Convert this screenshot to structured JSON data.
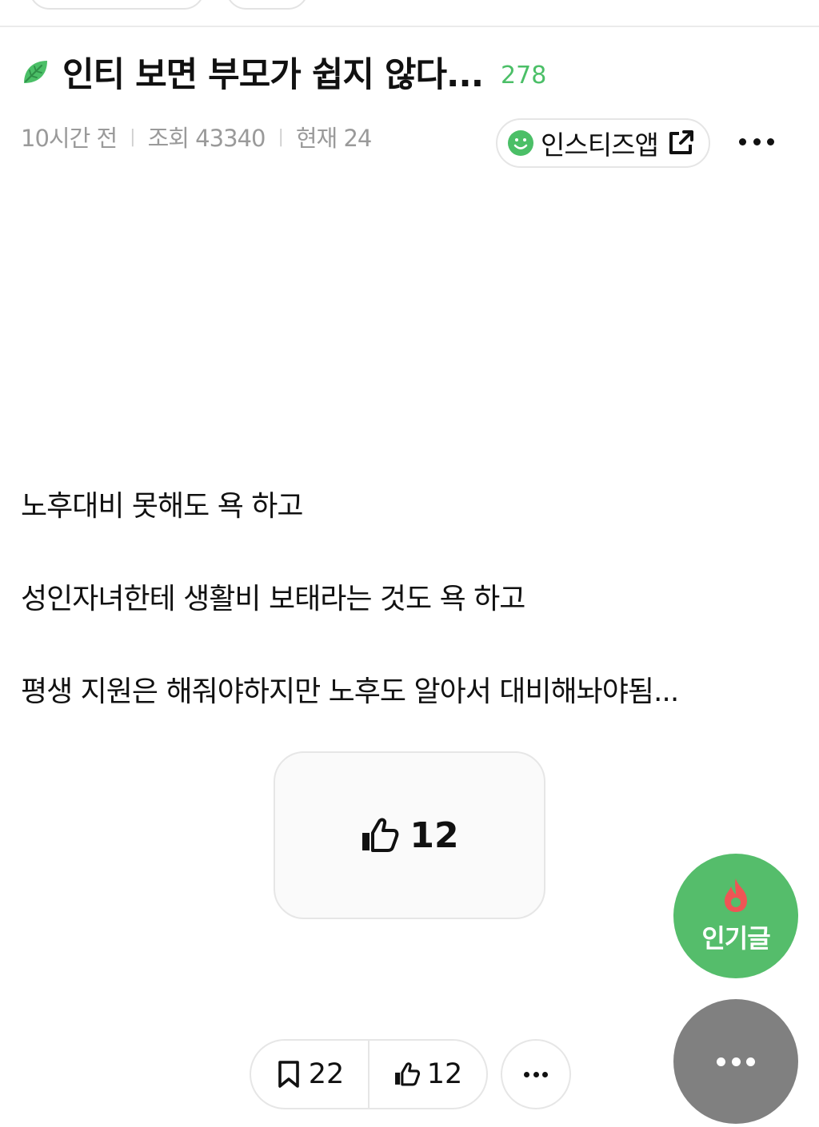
{
  "post": {
    "title": "인티 보면 부모가 쉽지 않다...",
    "comment_count": "278",
    "meta": {
      "time": "10시간 전",
      "views": "조회 43340",
      "current": "현재 24"
    },
    "app_button_label": "인스티즈앱",
    "body_lines": [
      "노후대비 못해도 욕 하고",
      "성인자녀한테 생활비 보태라는 것도 욕 하고",
      "평생 지원은 해줘야하지만 노후도 알아서 대비해놔야됨..."
    ],
    "like_count": "12"
  },
  "bottom_bar": {
    "bookmark_count": "22",
    "like_count": "12"
  },
  "fab": {
    "popular_label": "인기글"
  },
  "colors": {
    "accent_green": "#4bbf67",
    "fab_green": "#55bd6b",
    "fab_gray": "#808080",
    "fire_red": "#ee5555"
  }
}
